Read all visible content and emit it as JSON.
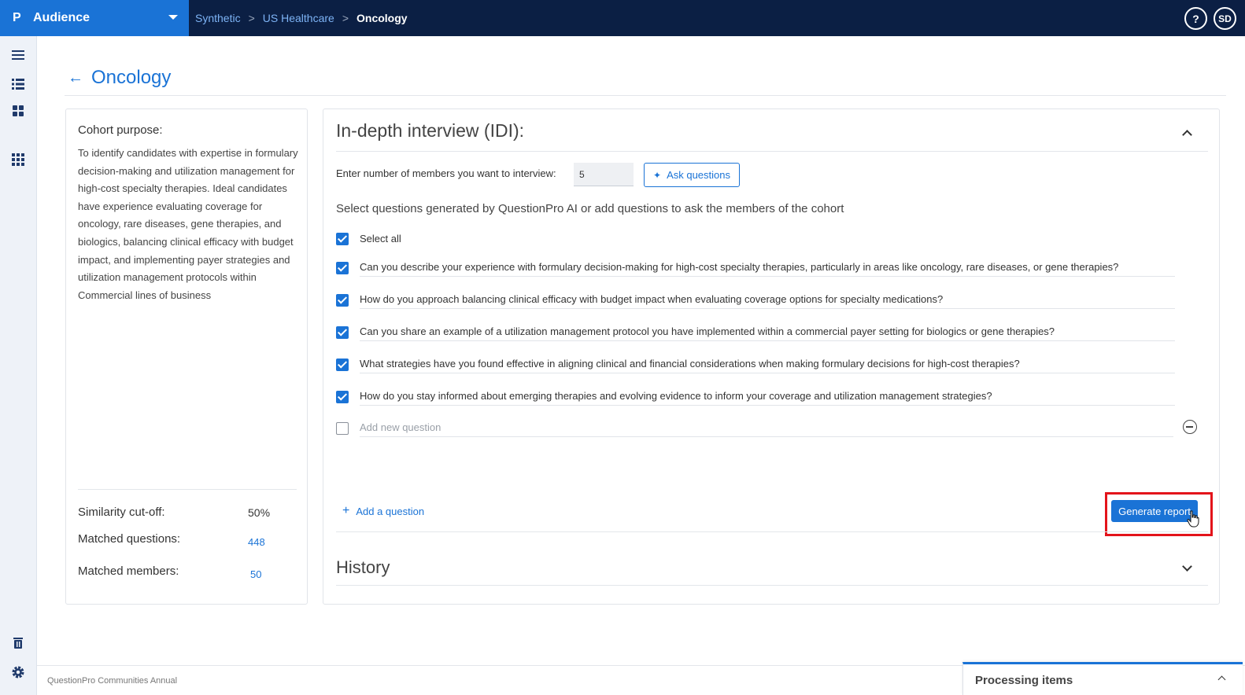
{
  "app": {
    "name": "Audience",
    "logo": "P"
  },
  "breadcrumb": {
    "items": [
      "Synthetic",
      "US Healthcare"
    ],
    "current": "Oncology",
    "separator": ">"
  },
  "header": {
    "help": "?",
    "avatar": "SD"
  },
  "page": {
    "title": "Oncology"
  },
  "cohort": {
    "purpose_label": "Cohort purpose:",
    "purpose_text": "To identify candidates with expertise in formulary decision-making and utilization management for high-cost specialty therapies. Ideal candidates have experience evaluating coverage for oncology, rare diseases, gene therapies, and biologics, balancing clinical efficacy with budget impact, and implementing payer strategies and utilization management protocols within Commercial lines of business",
    "similarity_label": "Similarity cut-off:",
    "similarity_value": "50%",
    "matched_questions_label": "Matched questions:",
    "matched_questions_value": "448",
    "matched_members_label": "Matched members:",
    "matched_members_value": "50"
  },
  "idi": {
    "title": "In-depth interview (IDI):",
    "members_label": "Enter number of members you want to interview:",
    "members_value": "5",
    "ask_label": "Ask questions",
    "select_prompt": "Select questions generated by QuestionPro AI or add questions to ask the members of the cohort",
    "select_all_label": "Select all",
    "questions": [
      "Can you describe your experience with formulary decision-making for high-cost specialty therapies, particularly in areas like oncology, rare diseases, or gene therapies?",
      "How do you approach balancing clinical efficacy with budget impact when evaluating coverage options for specialty medications?",
      "Can you share an example of a utilization management protocol you have implemented within a commercial payer setting for biologics or gene therapies?",
      "What strategies have you found effective in aligning clinical and financial considerations when making formulary decisions for high-cost therapies?",
      "How do you stay informed about emerging therapies and evolving evidence to inform your coverage and utilization management strategies?"
    ],
    "new_question_placeholder": "Add new question",
    "add_question_label": "Add a question",
    "generate_label": "Generate report"
  },
  "history": {
    "title": "History"
  },
  "footer": {
    "text": "QuestionPro Communities Annual",
    "processing_label": "Processing items"
  },
  "colors": {
    "primary": "#1a73d6",
    "topbar": "#0b1f44",
    "highlight": "#e3141b"
  }
}
